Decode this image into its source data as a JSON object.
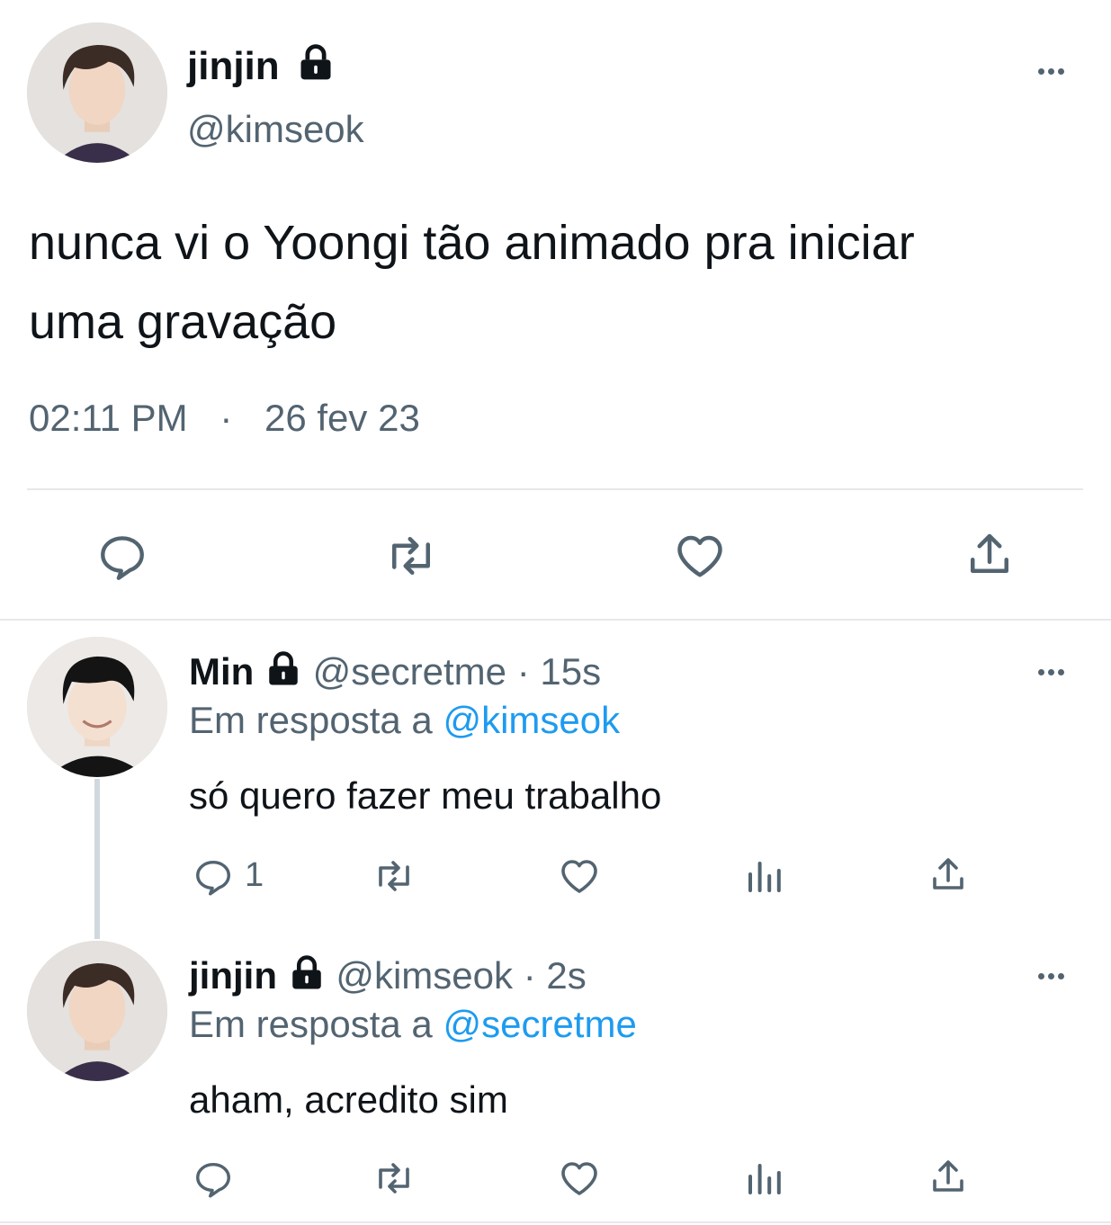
{
  "main_tweet": {
    "display_name": "jinjin",
    "handle": "@kimseok",
    "text_line1": "nunca vi o Yoongi tão animado pra iniciar",
    "text_line2": "uma gravação",
    "time": "02:11 PM",
    "separator": "·",
    "date": "26 fev 23"
  },
  "replies": [
    {
      "display_name": "Min",
      "handle": "@secretme",
      "time_sep": "·",
      "time": "15s",
      "reply_prefix": "Em resposta a",
      "reply_to": "@kimseok",
      "text": "só quero fazer meu trabalho",
      "reply_count": "1"
    },
    {
      "display_name": "jinjin",
      "handle": "@kimseok",
      "time_sep": "·",
      "time": "2s",
      "reply_prefix": "Em resposta a",
      "reply_to": "@secretme",
      "text": "aham, acredito sim",
      "reply_count": ""
    }
  ],
  "icons": {
    "lock": "lock-icon",
    "more": "more-icon",
    "reply": "reply-icon",
    "retweet": "retweet-icon",
    "like": "like-icon",
    "views": "views-icon",
    "share": "share-icon"
  },
  "colors": {
    "text": "#0f1419",
    "secondary": "#536471",
    "accent": "#1d9bf0",
    "divider": "#e6e8eb"
  }
}
